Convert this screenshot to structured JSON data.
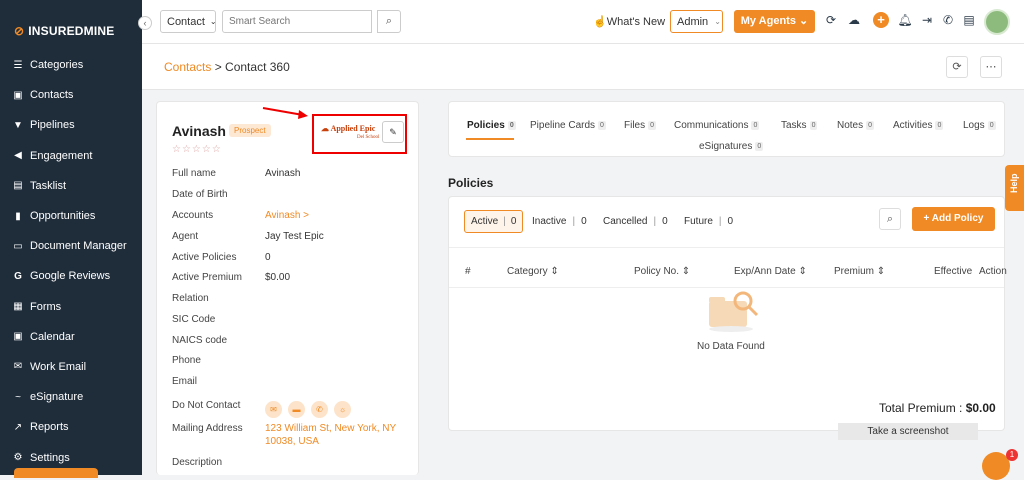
{
  "brand": {
    "name_bold": "INSUREDMINE"
  },
  "sidebar": {
    "items": [
      {
        "label": "Categories",
        "icon": "list-icon"
      },
      {
        "label": "Contacts",
        "icon": "contact-card-icon"
      },
      {
        "label": "Pipelines",
        "icon": "funnel-icon"
      },
      {
        "label": "Engagement",
        "icon": "megaphone-icon"
      },
      {
        "label": "Tasklist",
        "icon": "tasklist-icon"
      },
      {
        "label": "Opportunities",
        "icon": "bar-chart-icon"
      },
      {
        "label": "Document Manager",
        "icon": "folder-icon"
      },
      {
        "label": "Google Reviews",
        "icon": "google-icon"
      },
      {
        "label": "Forms",
        "icon": "form-icon"
      },
      {
        "label": "Calendar",
        "icon": "calendar-icon"
      },
      {
        "label": "Work Email",
        "icon": "mail-icon"
      },
      {
        "label": "eSignature",
        "icon": "signature-icon"
      },
      {
        "label": "Reports",
        "icon": "line-chart-icon"
      },
      {
        "label": "Settings",
        "icon": "gear-icon"
      }
    ]
  },
  "topbar": {
    "search_type": "Contact",
    "search_placeholder": "Smart Search",
    "whats_new": "What's New",
    "role": "Admin",
    "my_agents": "My Agents"
  },
  "breadcrumb": {
    "parent": "Contacts",
    "separator": " > ",
    "current": "Contact 360"
  },
  "contact": {
    "name": "Avinash",
    "status": "Prospect",
    "stars": "☆☆☆☆☆",
    "epic_logo": "Applied Epic",
    "epic_sub": "Del School",
    "fields": [
      {
        "label": "Full name",
        "value": "Avinash"
      },
      {
        "label": "Date of Birth",
        "value": ""
      },
      {
        "label": "Accounts",
        "value": "Avinash >"
      },
      {
        "label": "Agent",
        "value": "Jay Test Epic"
      },
      {
        "label": "Active Policies",
        "value": "0"
      },
      {
        "label": "Active Premium",
        "value": "$0.00"
      },
      {
        "label": "Relation",
        "value": ""
      },
      {
        "label": "SIC Code",
        "value": ""
      },
      {
        "label": "NAICS code",
        "value": ""
      },
      {
        "label": "Phone",
        "value": ""
      },
      {
        "label": "Email",
        "value": ""
      }
    ],
    "do_not_contact": "Do Not Contact",
    "mailing_label": "Mailing Address",
    "mailing_line1": "123 William St, New York, NY",
    "mailing_line2": "10038, USA",
    "description": "Description"
  },
  "tabs": [
    {
      "label": "Policies",
      "count": "0"
    },
    {
      "label": "Pipeline Cards",
      "count": "0"
    },
    {
      "label": "Files",
      "count": "0"
    },
    {
      "label": "Communications",
      "count": "0"
    },
    {
      "label": "Tasks",
      "count": "0"
    },
    {
      "label": "Notes",
      "count": "0"
    },
    {
      "label": "Activities",
      "count": "0"
    },
    {
      "label": "Logs",
      "count": "0"
    },
    {
      "label": "eSignatures",
      "count": "0"
    }
  ],
  "policies": {
    "title": "Policies",
    "filters": [
      {
        "label": "Active",
        "count": "0"
      },
      {
        "label": "Inactive",
        "count": "0"
      },
      {
        "label": "Cancelled",
        "count": "0"
      },
      {
        "label": "Future",
        "count": "0"
      }
    ],
    "add_label": "Add Policy",
    "columns": [
      "#",
      "Category",
      "Policy No.",
      "Exp/Ann Date",
      "Premium",
      "Effective",
      "Action"
    ],
    "empty": "No Data Found",
    "total_label": "Total Premium : ",
    "total_value": "$0.00"
  },
  "overlay": {
    "screenshot": "Take a screenshot",
    "help": "Help",
    "chat_badge": "1"
  },
  "colors": {
    "accent": "#f08a24",
    "sidebar": "#1f2d3b"
  }
}
